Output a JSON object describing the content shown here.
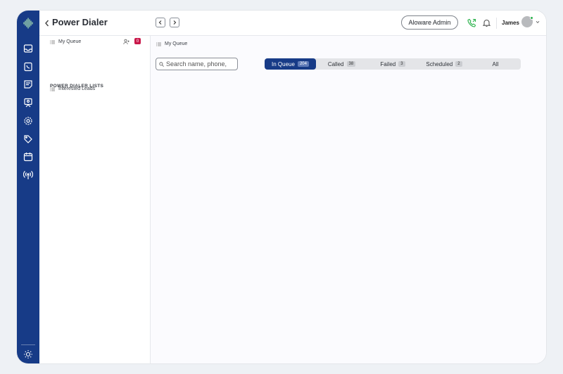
{
  "header": {
    "title": "Power Dialer",
    "admin_label": "Aloware Admin",
    "user_name": "James"
  },
  "rail": {
    "icons": [
      "logo-icon",
      "inbox-icon",
      "contacts-icon",
      "notes-icon",
      "broadcast-icon",
      "settings-icon",
      "tag-icon",
      "calendar-icon",
      "antenna-icon",
      "theme-sun-icon"
    ]
  },
  "sidebar": {
    "my_queue_label": "My Queue",
    "my_queue_count": "0",
    "section_title": "POWER DIALER LISTS",
    "add_label": "+",
    "lists": [
      {
        "label": "Interested Leads"
      }
    ]
  },
  "main": {
    "breadcrumb": "My Queue",
    "search_placeholder": "Search name, phone,",
    "tabs": [
      {
        "label": "In Queue",
        "count": "204"
      },
      {
        "label": "Called",
        "count": "38"
      },
      {
        "label": "Failed",
        "count": "3"
      },
      {
        "label": "Scheduled",
        "count": "2"
      },
      {
        "label": "All",
        "count": ""
      }
    ]
  },
  "colors": {
    "rail": "#173b87",
    "active_tab": "#173b87",
    "badge": "#c9184a",
    "status_online": "#2bb24c"
  }
}
